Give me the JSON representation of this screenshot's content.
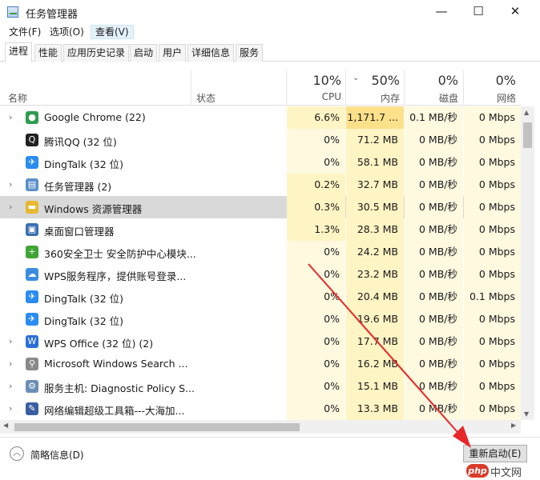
{
  "window": {
    "title": "任务管理器",
    "minimize": "—",
    "maximize": "☐",
    "close": "✕"
  },
  "menu": [
    "文件(F)",
    "选项(O)",
    "查看(V)"
  ],
  "tabs": [
    "进程",
    "性能",
    "应用历史记录",
    "启动",
    "用户",
    "详细信息",
    "服务"
  ],
  "columns": {
    "name": "名称",
    "status": "状态",
    "cpu": {
      "pct": "10%",
      "label": "CPU"
    },
    "mem": {
      "pct": "50%",
      "label": "内存"
    },
    "disk": {
      "pct": "0%",
      "label": "磁盘"
    },
    "net": {
      "pct": "0%",
      "label": "网络"
    }
  },
  "rows": [
    {
      "name": "Google Chrome (22)",
      "cpu": "6.6%",
      "mem": "1,171.7 ...",
      "disk": "0.1 MB/秒",
      "net": "0 Mbps",
      "expandable": true,
      "icon": "chrome-icon",
      "color": "#2e9d4e",
      "glyph": "●"
    },
    {
      "name": "腾讯QQ (32 位)",
      "cpu": "0%",
      "mem": "71.2 MB",
      "disk": "0 MB/秒",
      "net": "0 Mbps",
      "expandable": false,
      "icon": "qq-icon",
      "color": "#222222",
      "glyph": "Q"
    },
    {
      "name": "DingTalk (32 位)",
      "cpu": "0%",
      "mem": "58.1 MB",
      "disk": "0 MB/秒",
      "net": "0 Mbps",
      "expandable": false,
      "icon": "dingtalk-icon",
      "color": "#2a8cf0",
      "glyph": "✈"
    },
    {
      "name": "任务管理器 (2)",
      "cpu": "0.2%",
      "mem": "32.7 MB",
      "disk": "0 MB/秒",
      "net": "0 Mbps",
      "expandable": true,
      "icon": "taskmgr-icon",
      "color": "#5b8fc7",
      "glyph": "▤"
    },
    {
      "name": "Windows 资源管理器",
      "cpu": "0.3%",
      "mem": "30.5 MB",
      "disk": "0 MB/秒",
      "net": "0 Mbps",
      "expandable": true,
      "icon": "folder-icon",
      "color": "#e8b830",
      "glyph": "▬"
    },
    {
      "name": "桌面窗口管理器",
      "cpu": "1.3%",
      "mem": "28.3 MB",
      "disk": "0 MB/秒",
      "net": "0 Mbps",
      "expandable": false,
      "icon": "dwm-icon",
      "color": "#3a6fb0",
      "glyph": "▣"
    },
    {
      "name": "360安全卫士 安全防护中心模块...",
      "cpu": "0%",
      "mem": "24.2 MB",
      "disk": "0 MB/秒",
      "net": "0 Mbps",
      "expandable": false,
      "icon": "360-icon",
      "color": "#3fa535",
      "glyph": "+"
    },
    {
      "name": "WPS服务程序，提供账号登录...",
      "cpu": "0%",
      "mem": "23.2 MB",
      "disk": "0 MB/秒",
      "net": "0 Mbps",
      "expandable": false,
      "icon": "wps-cloud-icon",
      "color": "#3b8de0",
      "glyph": "☁"
    },
    {
      "name": "DingTalk (32 位)",
      "cpu": "0%",
      "mem": "20.4 MB",
      "disk": "0 MB/秒",
      "net": "0.1 Mbps",
      "expandable": false,
      "icon": "dingtalk-icon",
      "color": "#2a8cf0",
      "glyph": "✈"
    },
    {
      "name": "DingTalk (32 位)",
      "cpu": "0%",
      "mem": "19.6 MB",
      "disk": "0 MB/秒",
      "net": "0 Mbps",
      "expandable": false,
      "icon": "dingtalk-icon",
      "color": "#2a8cf0",
      "glyph": "✈"
    },
    {
      "name": "WPS Office (32 位) (2)",
      "cpu": "0%",
      "mem": "17.7 MB",
      "disk": "0 MB/秒",
      "net": "0 Mbps",
      "expandable": true,
      "icon": "wps-icon",
      "color": "#2d6fd6",
      "glyph": "W"
    },
    {
      "name": "Microsoft Windows Search ...",
      "cpu": "0%",
      "mem": "16.2 MB",
      "disk": "0 MB/秒",
      "net": "0 Mbps",
      "expandable": true,
      "icon": "search-service-icon",
      "color": "#8a8a8a",
      "glyph": "⚲"
    },
    {
      "name": "服务主机: Diagnostic Policy S...",
      "cpu": "0%",
      "mem": "15.1 MB",
      "disk": "0 MB/秒",
      "net": "0 Mbps",
      "expandable": true,
      "icon": "gear-icon",
      "color": "#6b8fb5",
      "glyph": "⚙"
    },
    {
      "name": "网络编辑超级工具箱---大海加...",
      "cpu": "0%",
      "mem": "13.3 MB",
      "disk": "0 MB/秒",
      "net": "0 Mbps",
      "expandable": true,
      "icon": "pen-icon",
      "color": "#3a5fa0",
      "glyph": "✎"
    }
  ],
  "footer": {
    "fewer_details": "简略信息(D)",
    "end_task": "重新启动(E)"
  },
  "watermark": {
    "logo": "php",
    "text": "中文网"
  },
  "colors": {
    "cpu_cell": "#fff4c4",
    "mem_cell_high": "#fce08a",
    "mem_cell": "#fff4c4",
    "cell_light": "#fff9e0",
    "arrow": "#e8272a"
  }
}
